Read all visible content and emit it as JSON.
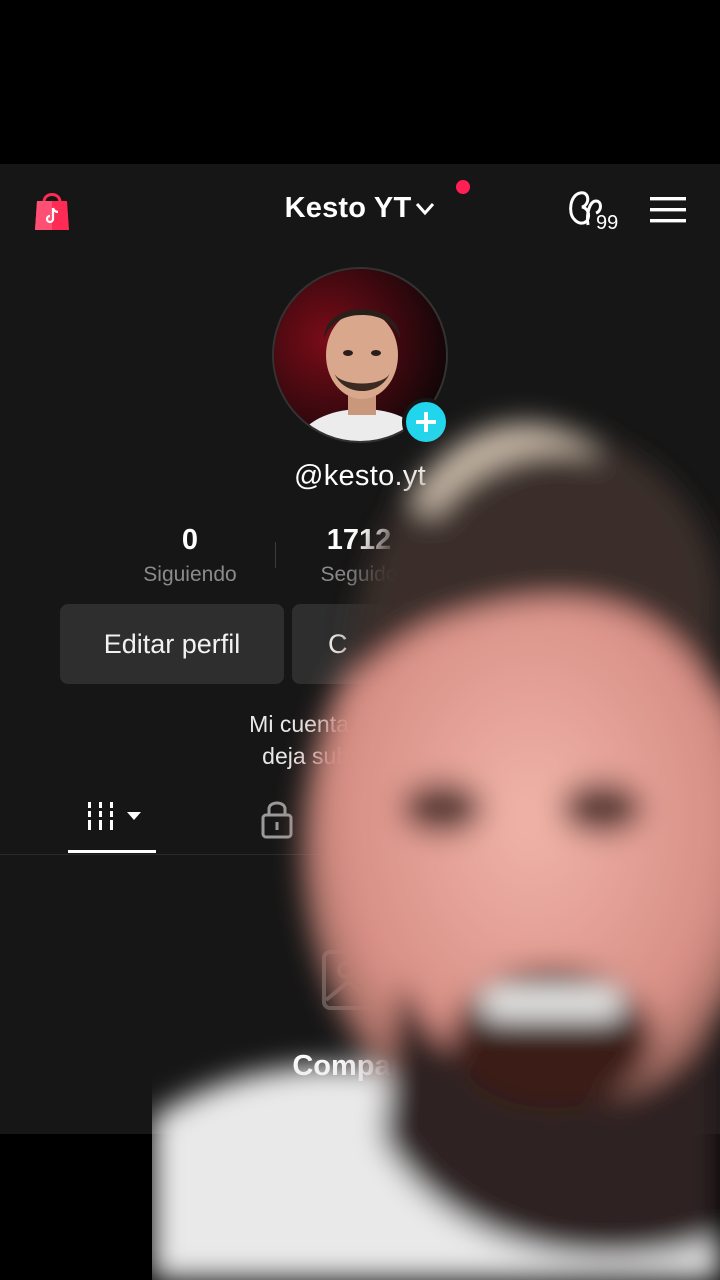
{
  "header": {
    "account_name": "Kesto YT",
    "shop_icon": "shopping-bag-icon",
    "activity_icon": "activity-icon",
    "activity_badge": "99",
    "menu_icon": "hamburger-menu-icon"
  },
  "profile": {
    "username": "@kesto.yt",
    "stats": [
      {
        "value": "0",
        "label": "Siguiendo"
      },
      {
        "value": "1712",
        "label": "Seguido"
      }
    ],
    "edit_button": "Editar perfil",
    "second_button_partial": "C",
    "bio_line1": "Mi cuenta principal \"K",
    "bio_line2": "deja subir nada, en"
  },
  "tabs": {
    "videos_icon": "grid-videos-icon",
    "private_icon": "lock-icon"
  },
  "empty_state": {
    "icon": "photo-icon",
    "title": "Comparte"
  },
  "colors": {
    "background": "#161616",
    "accent_cyan": "#20d5ec",
    "notification": "#ff1f55",
    "shop_bag": "#fe2c55"
  }
}
